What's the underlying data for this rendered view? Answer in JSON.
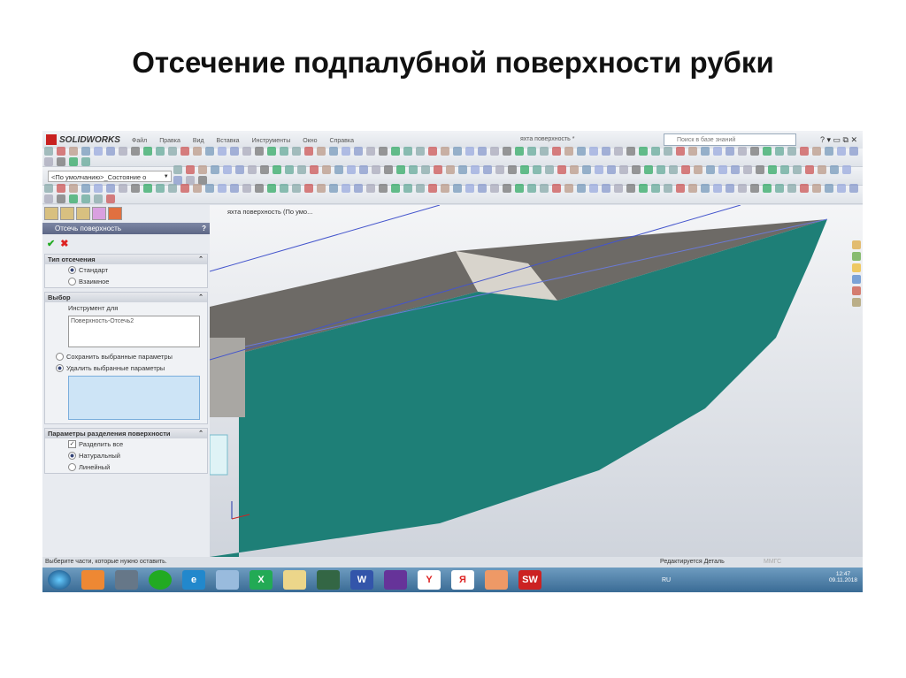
{
  "slide_title": "Отсечение подпалубной поверхности рубки",
  "app": {
    "name": "SOLIDWORKS",
    "window_title": "яхта поверхность *",
    "menu": [
      "Файл",
      "Правка",
      "Вид",
      "Вставка",
      "Инструменты",
      "Окно",
      "Справка"
    ],
    "search_placeholder": "Поиск в базе знаний",
    "config_select": "<По умолчанию>_Состояние о"
  },
  "tree": {
    "item": "яхта поверхность (По умо..."
  },
  "panel": {
    "title": "Отсечь поверхность",
    "help": "?",
    "group1": {
      "title": "Тип отсечения",
      "options": [
        "Стандарт",
        "Взаимное"
      ],
      "selected": 0
    },
    "group2": {
      "title": "Выбор",
      "label": "Инструмент для",
      "tool_value": "Поверхность-Отсечь2",
      "options": [
        "Сохранить выбранные параметры",
        "Удалить выбранные параметры"
      ],
      "selected": 1
    },
    "group3": {
      "title": "Параметры разделения поверхности",
      "checkbox": "Разделить все",
      "checked": true,
      "options": [
        "Натуральный",
        "Линейный"
      ],
      "selected": 0
    }
  },
  "status": {
    "left": "Выберите части, которые нужно оставить.",
    "right": "Редактируется Деталь",
    "units": "ММГС"
  },
  "taskbar": {
    "lang": "RU",
    "time": "12:47",
    "date": "09.11.2018",
    "apps": [
      "Y",
      "Я",
      "SW"
    ]
  },
  "colors": {
    "hull": "#1e7f77",
    "deck": "#6d6a66"
  }
}
